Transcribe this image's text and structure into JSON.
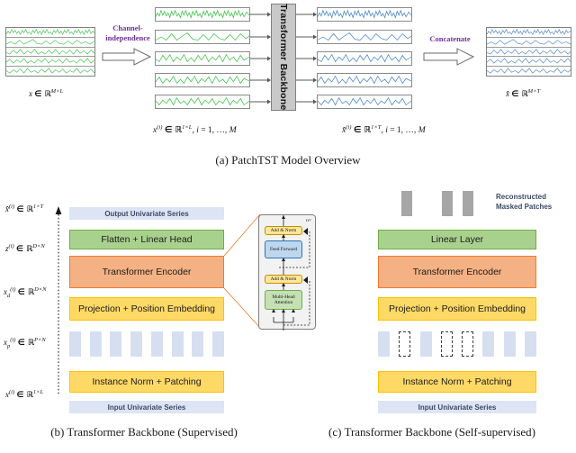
{
  "figure": {
    "captions": {
      "a": "(a) PatchTST Model Overview",
      "b": "(b) Transformer Backbone (Supervised)",
      "c": "(c) Transformer Backbone (Self-supervised)"
    }
  },
  "panel_a": {
    "input_label": "x ∈ ℝ^{M×L}",
    "input_label_parts": {
      "var": "x",
      "in": "∈",
      "set": "ℝ",
      "sup": "M×L"
    },
    "channel_independence_label": "Channel-\nindependence",
    "channel_independence_line1": "Channel-",
    "channel_independence_line2": "independence",
    "concatenate_label": "Concatenate",
    "backbone_label": "Transformer Backbone",
    "univariate_in_label": {
      "var": "x",
      "supvar": "(i)",
      "in": "∈",
      "set": "ℝ",
      "sup": "1×L",
      "tail": ", i = 1, …, M"
    },
    "univariate_out_label": {
      "var": "x̂",
      "supvar": "(i)",
      "in": "∈",
      "set": "ℝ",
      "sup": "1×T",
      "tail": ", i = 1, …, M"
    },
    "output_label_parts": {
      "var": "x̂",
      "in": "∈",
      "set": "ℝ",
      "sup": "M×T"
    },
    "num_channels": 5,
    "input_series_color": "#3fc34a",
    "output_series_color": "#4a86c8",
    "backbone_fill": "#c9c9c9",
    "accent_purple": "#7030a0"
  },
  "panel_b": {
    "title": "Transformer Backbone (Supervised)",
    "blocks": [
      {
        "label": "Output Univariate Series",
        "style": "io"
      },
      {
        "label": "Flatten + Linear Head",
        "style": "green"
      },
      {
        "label": "Transformer Encoder",
        "style": "salmon"
      },
      {
        "label": "Projection + Position Embedding",
        "style": "yellow"
      },
      {
        "label": "Instance Norm + Patching",
        "style": "yellow"
      },
      {
        "label": "Input Univariate Series",
        "style": "io"
      }
    ],
    "patches_count": 8,
    "side_labels": [
      {
        "var": "x̂",
        "supvar": "(i)",
        "sub": "",
        "set": "ℝ",
        "sup": "1×T"
      },
      {
        "var": "z",
        "supvar": "(i)",
        "sub": "",
        "set": "ℝ",
        "sup": "D×N"
      },
      {
        "var": "x",
        "supvar": "(i)",
        "sub": "d",
        "set": "ℝ",
        "sup": "D×N"
      },
      {
        "var": "x",
        "supvar": "(i)",
        "sub": "p",
        "set": "ℝ",
        "sup": "P×N"
      },
      {
        "var": "x",
        "supvar": "(i)",
        "sub": "",
        "set": "ℝ",
        "sup": "1×L"
      }
    ],
    "encoder_detail": {
      "repeat_label": "n×",
      "items": [
        {
          "label": "Add & Norm",
          "style": "yellow"
        },
        {
          "label": "Feed Forward",
          "style": "blue"
        },
        {
          "label": "Add & Norm",
          "style": "yellow"
        },
        {
          "label": "Multi-Head Attention",
          "style": "green"
        }
      ]
    }
  },
  "panel_c": {
    "title": "Transformer Backbone (Self-supervised)",
    "reconstructed_label_line1": "Reconstructed",
    "reconstructed_label_line2": "Masked Patches",
    "reconstructed_patches": 3,
    "blocks": [
      {
        "label": "Linear Layer",
        "style": "green"
      },
      {
        "label": "Transformer Encoder",
        "style": "salmon"
      },
      {
        "label": "Projection + Position Embedding",
        "style": "yellow"
      },
      {
        "label": "Instance Norm + Patching",
        "style": "yellow"
      },
      {
        "label": "Input Univariate Series",
        "style": "io"
      }
    ],
    "patch_mask": [
      "solid",
      "masked",
      "solid",
      "masked",
      "masked",
      "solid",
      "solid",
      "solid"
    ]
  },
  "colors": {
    "io_fill": "#dde4f3",
    "io_text": "#3b4a66",
    "green_fill": "#a9d18e",
    "green_border": "#70ad47",
    "salmon_fill": "#f4b183",
    "salmon_border": "#ed7d31",
    "yellow_fill": "#ffd966",
    "yellow_border": "#ffc000",
    "patch_fill": "#d6dff0",
    "gray_patch": "#a6a6a6"
  }
}
